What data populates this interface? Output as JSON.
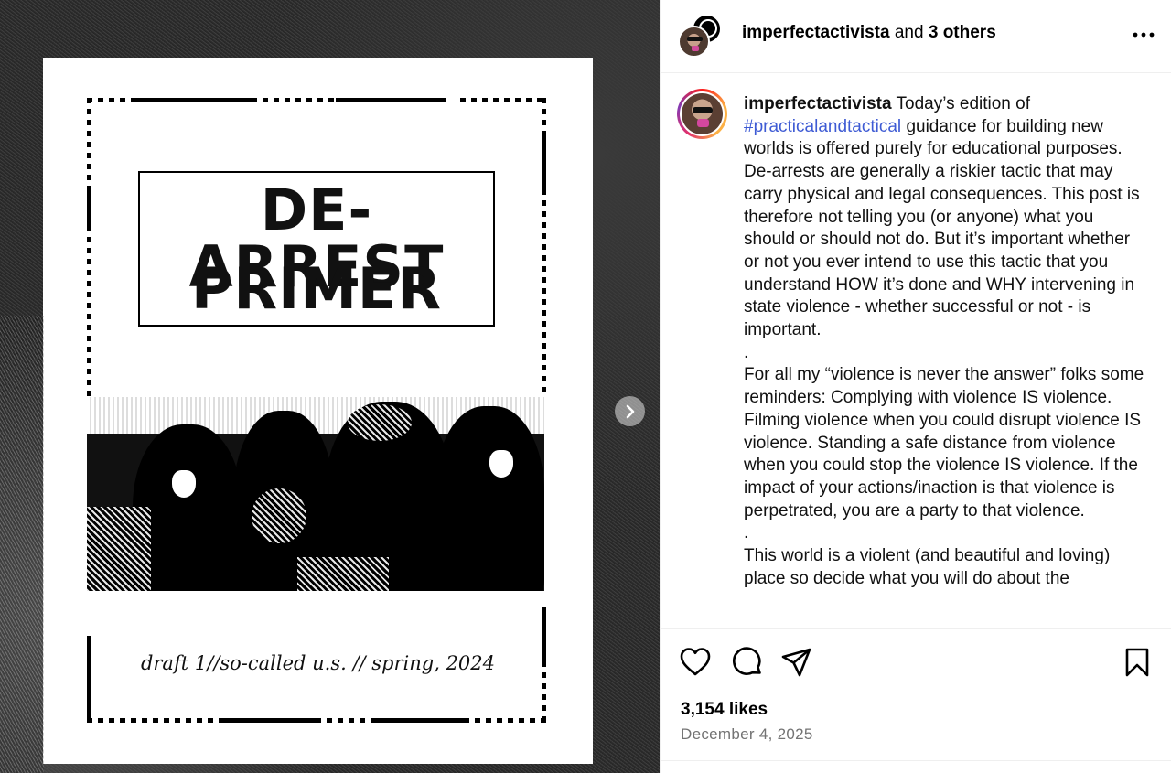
{
  "media": {
    "poster": {
      "title_line1": "DE-ARREST",
      "title_line2": "PRIMER",
      "footer": "draft 1//so-called u.s. // spring, 2024"
    },
    "next_button_icon": "chevron-right-icon"
  },
  "header": {
    "username": "imperfectactivista",
    "joiner": "and",
    "others": "3 others",
    "more_icon": "more-horizontal-icon"
  },
  "caption": {
    "username": "imperfectactivista",
    "intro": "Today’s edition of",
    "hashtag": "#practicalandtactical",
    "paragraph1_rest": "guidance for building new worlds is offered purely for educational purposes. De-arrests are generally a riskier tactic that may carry physical and legal consequences. This post is therefore not telling you (or anyone) what you should or should not do. But it’s important whether or not you ever intend to use this tactic that you understand HOW it’s done and WHY intervening in state violence - whether successful or not - is important.",
    "separator1": ".",
    "paragraph2": "For all my “violence is never the answer” folks some reminders: Complying with violence IS violence. Filming violence when you could disrupt violence IS violence. Standing a safe distance from violence when you could stop the violence IS violence. If the impact of your actions/inaction is that violence is perpetrated, you are a party to that violence.",
    "separator2": ".",
    "paragraph3": "This world is a violent (and beautiful and loving) place so decide what you will do about the"
  },
  "actions": {
    "icons": [
      "heart-icon",
      "comment-icon",
      "share-icon",
      "bookmark-icon"
    ],
    "likes": "3,154 likes",
    "date": "December 4, 2025"
  }
}
